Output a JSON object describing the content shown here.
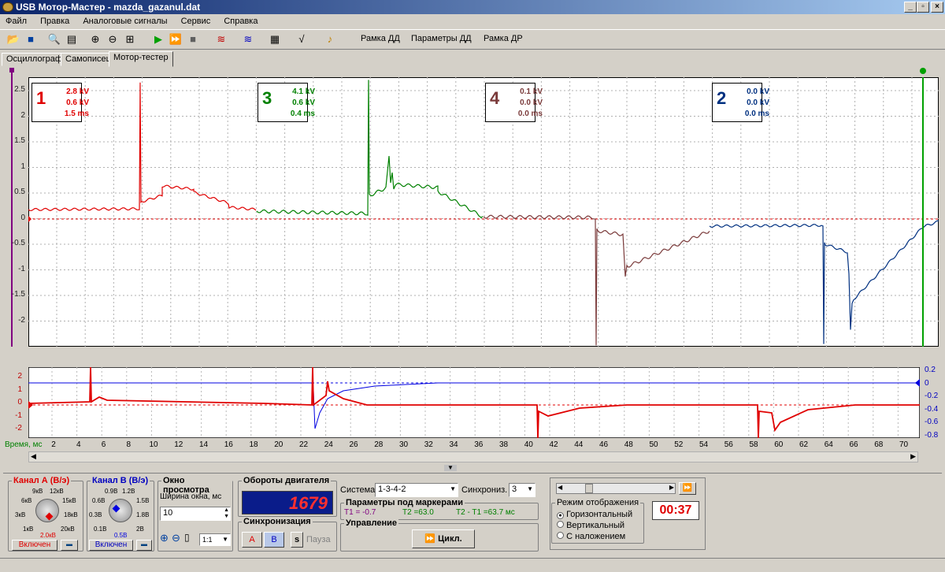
{
  "window": {
    "title": "USB Мотор-Мастер - mazda_gazanul.dat"
  },
  "menu": [
    "Файл",
    "Правка",
    "Аналоговые сигналы",
    "Сервис",
    "Справка"
  ],
  "toolbar": {
    "frame_dd": "Рамка ДД",
    "params_dd": "Параметры ДД",
    "frame_dr": "Рамка ДР"
  },
  "tabs": [
    "Осциллограф",
    "Самописец",
    "Мотор-тестер"
  ],
  "scope": {
    "y_ticks": [
      "2.5",
      "2",
      "1.5",
      "1",
      "0.5",
      "0",
      "-0.5",
      "-1",
      "-1.5",
      "-2"
    ],
    "cylinders": [
      {
        "num": "1",
        "vals": [
          "2.8 kV",
          "0.6 kV",
          "1.5 ms"
        ],
        "color": "#e00000"
      },
      {
        "num": "3",
        "vals": [
          "4.1 kV",
          "0.6 kV",
          "0.4 ms"
        ],
        "color": "#008000"
      },
      {
        "num": "4",
        "vals": [
          "0.1 kV",
          "0.0 kV",
          "0.0 ms"
        ],
        "color": "#7a3a3a"
      },
      {
        "num": "2",
        "vals": [
          "0.0 kV",
          "0.0 kV",
          "0.0 ms"
        ],
        "color": "#003080"
      }
    ]
  },
  "overview": {
    "left_ticks": [
      "2",
      "1",
      "0",
      "-1",
      "-2"
    ],
    "right_ticks": [
      "0.2",
      "0",
      "-0.2",
      "-0.4",
      "-0.6",
      "-0.8"
    ],
    "time_label": "Время, мс",
    "x_ticks": [
      "2",
      "4",
      "6",
      "8",
      "10",
      "12",
      "14",
      "16",
      "18",
      "20",
      "22",
      "24",
      "26",
      "28",
      "30",
      "32",
      "34",
      "36",
      "38",
      "40",
      "42",
      "44",
      "46",
      "48",
      "50",
      "52",
      "54",
      "56",
      "58",
      "60",
      "62",
      "64",
      "66",
      "68",
      "70"
    ]
  },
  "chan_a": {
    "title": "Канал А (В/э)",
    "scale": [
      "9кВ",
      "12кВ",
      "6кВ",
      "15кВ",
      "3кВ",
      "18кВ",
      "1кВ",
      "20кВ"
    ],
    "value": "2.0кВ",
    "on": "Включен"
  },
  "chan_b": {
    "title": "Канал В (В/э)",
    "scale": [
      "0.9В",
      "1.2В",
      "0.6В",
      "1.5В",
      "0.3В",
      "1.8В",
      "0.1В",
      "2В"
    ],
    "value": "0.5В",
    "on": "Включен"
  },
  "view_window": {
    "title": "Окно просмотра",
    "width_label": "Ширина окна, мс",
    "width": "10",
    "zoom": "1:1"
  },
  "rpm": {
    "title": "Обороты двигателя",
    "value": "1679"
  },
  "sync_group": {
    "title": "Синхронизация",
    "a": "A",
    "b": "B",
    "s": "s",
    "pause": "Пауза"
  },
  "system": {
    "label": "Система",
    "value": "1-3-4-2",
    "sync_label": "Синхрониз.",
    "sync_value": "3"
  },
  "markers": {
    "title": "Параметры под маркерами",
    "t1": "T1 = -0.7",
    "t2": "T2 =63.0",
    "diff": "T2 - T1 =63.7   мс"
  },
  "control": {
    "title": "Управление",
    "cycle": "Цикл."
  },
  "display_mode": {
    "title": "Режим отображения",
    "options": [
      "Горизонтальный",
      "Вертикальный",
      "С наложением"
    ],
    "selected": 0
  },
  "timer": "00:37",
  "colors": {
    "red": "#e00000",
    "blue": "#0000e0",
    "green": "#008000",
    "brown": "#7a3a3a",
    "navy": "#003080"
  }
}
